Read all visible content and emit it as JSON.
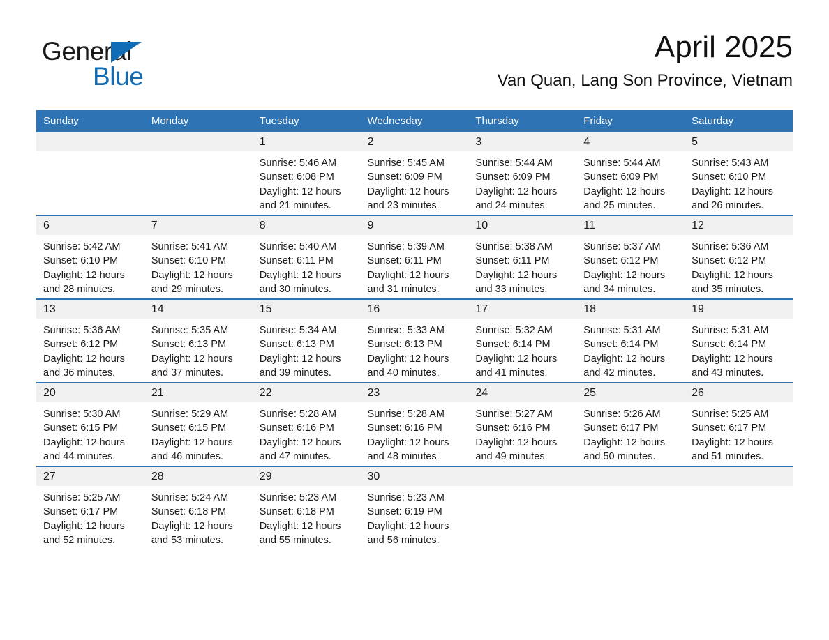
{
  "brand": {
    "name_part1": "General",
    "name_part2": "Blue",
    "triangle_color": "#0f6cb5",
    "text_color": "#1a1a1a"
  },
  "header": {
    "month_title": "April 2025",
    "location": "Van Quan, Lang Son Province, Vietnam"
  },
  "theme": {
    "header_blue": "#2e74b5",
    "daynum_band": "#f0f0f0",
    "page_background": "#ffffff",
    "text": "#1a1a1a"
  },
  "calendar": {
    "weekday_headers": [
      "Sunday",
      "Monday",
      "Tuesday",
      "Wednesday",
      "Thursday",
      "Friday",
      "Saturday"
    ],
    "weeks": [
      [
        {
          "day": "",
          "sunrise": "",
          "sunset": "",
          "daylight_line1": "",
          "daylight_line2": ""
        },
        {
          "day": "",
          "sunrise": "",
          "sunset": "",
          "daylight_line1": "",
          "daylight_line2": ""
        },
        {
          "day": "1",
          "sunrise": "Sunrise: 5:46 AM",
          "sunset": "Sunset: 6:08 PM",
          "daylight_line1": "Daylight: 12 hours",
          "daylight_line2": "and 21 minutes."
        },
        {
          "day": "2",
          "sunrise": "Sunrise: 5:45 AM",
          "sunset": "Sunset: 6:09 PM",
          "daylight_line1": "Daylight: 12 hours",
          "daylight_line2": "and 23 minutes."
        },
        {
          "day": "3",
          "sunrise": "Sunrise: 5:44 AM",
          "sunset": "Sunset: 6:09 PM",
          "daylight_line1": "Daylight: 12 hours",
          "daylight_line2": "and 24 minutes."
        },
        {
          "day": "4",
          "sunrise": "Sunrise: 5:44 AM",
          "sunset": "Sunset: 6:09 PM",
          "daylight_line1": "Daylight: 12 hours",
          "daylight_line2": "and 25 minutes."
        },
        {
          "day": "5",
          "sunrise": "Sunrise: 5:43 AM",
          "sunset": "Sunset: 6:10 PM",
          "daylight_line1": "Daylight: 12 hours",
          "daylight_line2": "and 26 minutes."
        }
      ],
      [
        {
          "day": "6",
          "sunrise": "Sunrise: 5:42 AM",
          "sunset": "Sunset: 6:10 PM",
          "daylight_line1": "Daylight: 12 hours",
          "daylight_line2": "and 28 minutes."
        },
        {
          "day": "7",
          "sunrise": "Sunrise: 5:41 AM",
          "sunset": "Sunset: 6:10 PM",
          "daylight_line1": "Daylight: 12 hours",
          "daylight_line2": "and 29 minutes."
        },
        {
          "day": "8",
          "sunrise": "Sunrise: 5:40 AM",
          "sunset": "Sunset: 6:11 PM",
          "daylight_line1": "Daylight: 12 hours",
          "daylight_line2": "and 30 minutes."
        },
        {
          "day": "9",
          "sunrise": "Sunrise: 5:39 AM",
          "sunset": "Sunset: 6:11 PM",
          "daylight_line1": "Daylight: 12 hours",
          "daylight_line2": "and 31 minutes."
        },
        {
          "day": "10",
          "sunrise": "Sunrise: 5:38 AM",
          "sunset": "Sunset: 6:11 PM",
          "daylight_line1": "Daylight: 12 hours",
          "daylight_line2": "and 33 minutes."
        },
        {
          "day": "11",
          "sunrise": "Sunrise: 5:37 AM",
          "sunset": "Sunset: 6:12 PM",
          "daylight_line1": "Daylight: 12 hours",
          "daylight_line2": "and 34 minutes."
        },
        {
          "day": "12",
          "sunrise": "Sunrise: 5:36 AM",
          "sunset": "Sunset: 6:12 PM",
          "daylight_line1": "Daylight: 12 hours",
          "daylight_line2": "and 35 minutes."
        }
      ],
      [
        {
          "day": "13",
          "sunrise": "Sunrise: 5:36 AM",
          "sunset": "Sunset: 6:12 PM",
          "daylight_line1": "Daylight: 12 hours",
          "daylight_line2": "and 36 minutes."
        },
        {
          "day": "14",
          "sunrise": "Sunrise: 5:35 AM",
          "sunset": "Sunset: 6:13 PM",
          "daylight_line1": "Daylight: 12 hours",
          "daylight_line2": "and 37 minutes."
        },
        {
          "day": "15",
          "sunrise": "Sunrise: 5:34 AM",
          "sunset": "Sunset: 6:13 PM",
          "daylight_line1": "Daylight: 12 hours",
          "daylight_line2": "and 39 minutes."
        },
        {
          "day": "16",
          "sunrise": "Sunrise: 5:33 AM",
          "sunset": "Sunset: 6:13 PM",
          "daylight_line1": "Daylight: 12 hours",
          "daylight_line2": "and 40 minutes."
        },
        {
          "day": "17",
          "sunrise": "Sunrise: 5:32 AM",
          "sunset": "Sunset: 6:14 PM",
          "daylight_line1": "Daylight: 12 hours",
          "daylight_line2": "and 41 minutes."
        },
        {
          "day": "18",
          "sunrise": "Sunrise: 5:31 AM",
          "sunset": "Sunset: 6:14 PM",
          "daylight_line1": "Daylight: 12 hours",
          "daylight_line2": "and 42 minutes."
        },
        {
          "day": "19",
          "sunrise": "Sunrise: 5:31 AM",
          "sunset": "Sunset: 6:14 PM",
          "daylight_line1": "Daylight: 12 hours",
          "daylight_line2": "and 43 minutes."
        }
      ],
      [
        {
          "day": "20",
          "sunrise": "Sunrise: 5:30 AM",
          "sunset": "Sunset: 6:15 PM",
          "daylight_line1": "Daylight: 12 hours",
          "daylight_line2": "and 44 minutes."
        },
        {
          "day": "21",
          "sunrise": "Sunrise: 5:29 AM",
          "sunset": "Sunset: 6:15 PM",
          "daylight_line1": "Daylight: 12 hours",
          "daylight_line2": "and 46 minutes."
        },
        {
          "day": "22",
          "sunrise": "Sunrise: 5:28 AM",
          "sunset": "Sunset: 6:16 PM",
          "daylight_line1": "Daylight: 12 hours",
          "daylight_line2": "and 47 minutes."
        },
        {
          "day": "23",
          "sunrise": "Sunrise: 5:28 AM",
          "sunset": "Sunset: 6:16 PM",
          "daylight_line1": "Daylight: 12 hours",
          "daylight_line2": "and 48 minutes."
        },
        {
          "day": "24",
          "sunrise": "Sunrise: 5:27 AM",
          "sunset": "Sunset: 6:16 PM",
          "daylight_line1": "Daylight: 12 hours",
          "daylight_line2": "and 49 minutes."
        },
        {
          "day": "25",
          "sunrise": "Sunrise: 5:26 AM",
          "sunset": "Sunset: 6:17 PM",
          "daylight_line1": "Daylight: 12 hours",
          "daylight_line2": "and 50 minutes."
        },
        {
          "day": "26",
          "sunrise": "Sunrise: 5:25 AM",
          "sunset": "Sunset: 6:17 PM",
          "daylight_line1": "Daylight: 12 hours",
          "daylight_line2": "and 51 minutes."
        }
      ],
      [
        {
          "day": "27",
          "sunrise": "Sunrise: 5:25 AM",
          "sunset": "Sunset: 6:17 PM",
          "daylight_line1": "Daylight: 12 hours",
          "daylight_line2": "and 52 minutes."
        },
        {
          "day": "28",
          "sunrise": "Sunrise: 5:24 AM",
          "sunset": "Sunset: 6:18 PM",
          "daylight_line1": "Daylight: 12 hours",
          "daylight_line2": "and 53 minutes."
        },
        {
          "day": "29",
          "sunrise": "Sunrise: 5:23 AM",
          "sunset": "Sunset: 6:18 PM",
          "daylight_line1": "Daylight: 12 hours",
          "daylight_line2": "and 55 minutes."
        },
        {
          "day": "30",
          "sunrise": "Sunrise: 5:23 AM",
          "sunset": "Sunset: 6:19 PM",
          "daylight_line1": "Daylight: 12 hours",
          "daylight_line2": "and 56 minutes."
        },
        {
          "day": "",
          "sunrise": "",
          "sunset": "",
          "daylight_line1": "",
          "daylight_line2": ""
        },
        {
          "day": "",
          "sunrise": "",
          "sunset": "",
          "daylight_line1": "",
          "daylight_line2": ""
        },
        {
          "day": "",
          "sunrise": "",
          "sunset": "",
          "daylight_line1": "",
          "daylight_line2": ""
        }
      ]
    ]
  }
}
